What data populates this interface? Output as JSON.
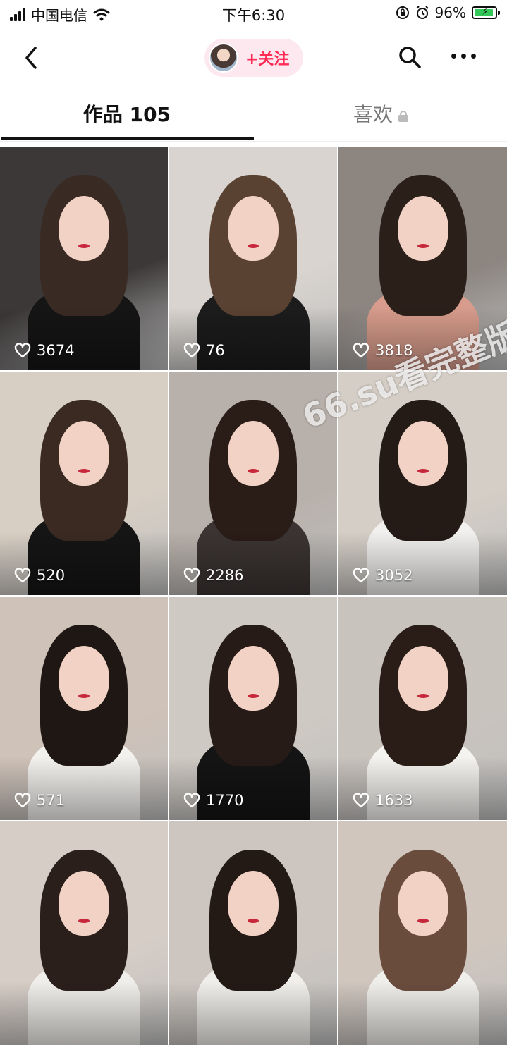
{
  "status_bar": {
    "carrier": "中国电信",
    "time": "下午6:30",
    "battery": "96%",
    "battery_level": 0.96
  },
  "nav": {
    "follow_label": "+关注"
  },
  "tabs": [
    {
      "label": "作品 105",
      "active": true
    },
    {
      "label": "喜欢",
      "locked": true,
      "active": false
    }
  ],
  "posts": [
    {
      "likes": "3674",
      "bg": "#3c3838",
      "hair": "#3a2a24",
      "torso": "#151515"
    },
    {
      "likes": "76",
      "bg": "#d9d4cf",
      "hair": "#5a4232",
      "torso": "#1c1c1c"
    },
    {
      "likes": "3818",
      "bg": "#8c8580",
      "hair": "#2b1f1a",
      "torso": "#d79c8c"
    },
    {
      "likes": "520",
      "bg": "#d8cfc4",
      "hair": "#3a2a22",
      "torso": "#151515"
    },
    {
      "likes": "2286",
      "bg": "#b8b0aa",
      "hair": "#2a1c16",
      "torso": "#3b3432"
    },
    {
      "likes": "3052",
      "bg": "#d5cec6",
      "hair": "#241a16",
      "torso": "#f1f0ee"
    },
    {
      "likes": "571",
      "bg": "#cfc2b8",
      "hair": "#1f1714",
      "torso": "#f3f1ee"
    },
    {
      "likes": "1770",
      "bg": "#cfc9c3",
      "hair": "#261b17",
      "torso": "#141414"
    },
    {
      "likes": "1633",
      "bg": "#c9c3be",
      "hair": "#2a1d18",
      "torso": "#f5f3f0"
    },
    {
      "likes": "",
      "bg": "#d6cdc6",
      "hair": "#2a1f1b",
      "torso": "#f0eeea"
    },
    {
      "likes": "",
      "bg": "#cdc6c0",
      "hair": "#231915",
      "torso": "#f0eeea"
    },
    {
      "likes": "",
      "bg": "#d0c6be",
      "hair": "#6a4c3d",
      "torso": "#f0eeea"
    }
  ],
  "watermark": "66.su看完整版",
  "colors": {
    "accent": "#fe2c55",
    "follow_bg": "#fce8ee"
  },
  "icons": [
    "back-icon",
    "search-icon",
    "more-icon",
    "heart-icon",
    "lock-icon",
    "wifi-icon",
    "signal-icon",
    "battery-icon",
    "alarm-icon",
    "orientation-lock-icon"
  ]
}
